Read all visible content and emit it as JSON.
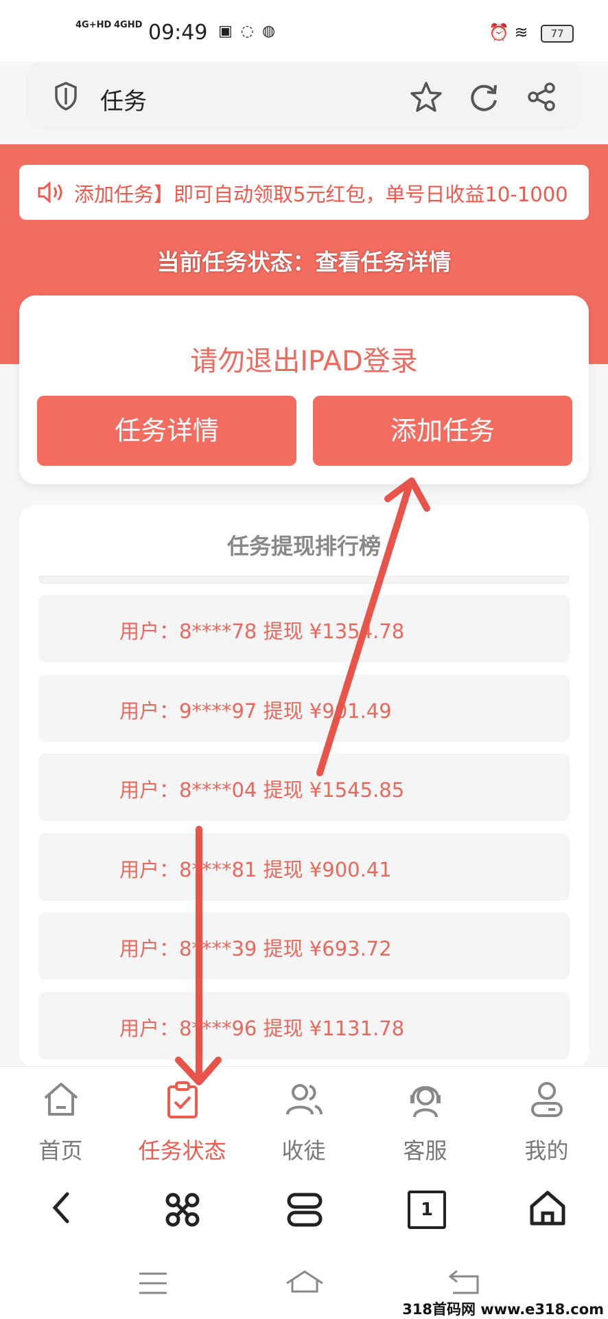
{
  "status_bar": {
    "network_1": "4G+HD",
    "network_2": "4GHD",
    "time": "09:49",
    "battery": "77"
  },
  "browser": {
    "page_title": "任务",
    "icons": [
      "shield-icon",
      "star-icon",
      "refresh-icon",
      "share-icon"
    ]
  },
  "notice": {
    "text": "添加任务】即可自动领取5元红包，单号日收益10-1000"
  },
  "header": {
    "status_text": "当前任务状态：查看任务详情"
  },
  "card": {
    "title": "请勿退出IPAD登录",
    "button_details": "任务详情",
    "button_add": "添加任务"
  },
  "ranking": {
    "title": "任务提现排行榜",
    "rows": [
      "用户：8****78 提现 ¥1354.78",
      "用户：9****97 提现 ¥901.49",
      "用户：8****04 提现 ¥1545.85",
      "用户：8****81 提现 ¥900.41",
      "用户：8****39 提现 ¥693.72",
      "用户：8****96 提现 ¥1131.78"
    ]
  },
  "tabs": [
    {
      "label": "首页",
      "icon": "home-icon",
      "active": false
    },
    {
      "label": "任务状态",
      "icon": "clipboard-check-icon",
      "active": true
    },
    {
      "label": "收徒",
      "icon": "users-icon",
      "active": false
    },
    {
      "label": "客服",
      "icon": "headset-icon",
      "active": false
    },
    {
      "label": "我的",
      "icon": "user-icon",
      "active": false
    }
  ],
  "browser_nav": {
    "tab_count": "1"
  },
  "watermark": "318首码网 www.e318.com",
  "colors": {
    "brand_red": "#f26d60",
    "text_red": "#e9685c",
    "arrow_red": "#e8534a"
  }
}
